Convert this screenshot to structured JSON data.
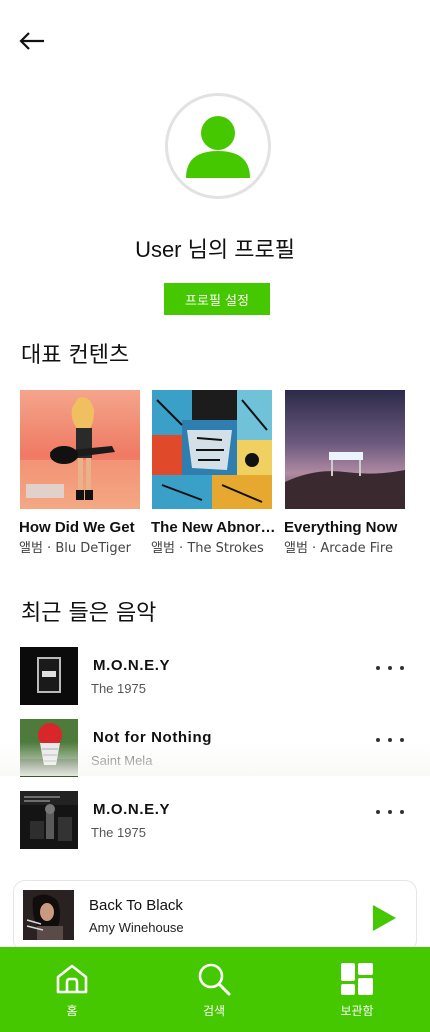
{
  "colors": {
    "accent": "#46c800",
    "text": "#111111",
    "subtext": "#555555"
  },
  "profile": {
    "name": "User 님의 프로필",
    "settings_label": "프로필 설정"
  },
  "featured": {
    "title": "대표 컨텐츠",
    "items": [
      {
        "title": "How Did We Get",
        "subtitle": "앨범 · Blu DeTiger",
        "cover_icon": "album-cover-guitarist"
      },
      {
        "title": "The New Abnormal",
        "subtitle": "앨범 · The Strokes",
        "cover_icon": "album-cover-painting"
      },
      {
        "title": "Everything Now",
        "subtitle": "앨범 · Arcade Fire",
        "cover_icon": "album-cover-billboard"
      }
    ]
  },
  "recent": {
    "title": "최근 들은 음악",
    "items": [
      {
        "song": "M.O.N.E.Y",
        "artist": "The 1975"
      },
      {
        "song": "Not for Nothing",
        "artist": "Saint Mela"
      },
      {
        "song": "M.O.N.E.Y",
        "artist": "The 1975"
      }
    ]
  },
  "player": {
    "song": "Back To Black",
    "artist": "Amy Winehouse"
  },
  "tabs": [
    {
      "label": "홈",
      "icon": "home-icon"
    },
    {
      "label": "검색",
      "icon": "search-icon"
    },
    {
      "label": "보관함",
      "icon": "library-icon"
    }
  ]
}
